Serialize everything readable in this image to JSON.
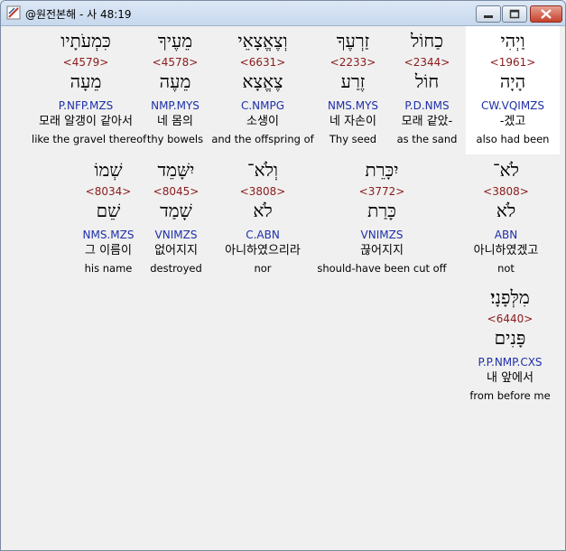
{
  "window": {
    "title": "@원전본해 - 사 48:19",
    "icons": {
      "app": "bible-app-icon",
      "minimize": "minimize-icon",
      "maximize": "maximize-icon",
      "close": "close-icon"
    }
  },
  "rows": [
    [
      {
        "heb": "וַיְהִי",
        "strong": "<1961>",
        "lemma": "הָיָה",
        "morph": "CW.VQIMZS",
        "kor": "-겠고",
        "eng": "also had been",
        "active": true
      },
      {
        "heb": "כַחוֹל",
        "strong": "<2344>",
        "lemma": "חוֹל",
        "morph": "P.D.NMS",
        "kor": "모래 같았-",
        "eng": "as the sand"
      },
      {
        "heb": "זַרְעֶךָ",
        "strong": "<2233>",
        "lemma": "זֶרַע",
        "morph": "NMS.MYS",
        "kor": "네 자손이",
        "eng": "Thy seed"
      },
      {
        "heb": "וְצֶאֱצָאֵי",
        "strong": "<6631>",
        "lemma": "צֶאֱצָא",
        "morph": "C.NMPG",
        "kor": "소생이",
        "eng": "and the offspring of"
      },
      {
        "heb": "מֵעֶיךָ",
        "strong": "<4578>",
        "lemma": "מֵעֶה",
        "morph": "NMP.MYS",
        "kor": "네 몸의",
        "eng": "thy bowels"
      },
      {
        "heb": "כִּמְעֹתָיו",
        "strong": "<4579>",
        "lemma": "מֵעָה",
        "morph": "P.NFP.MZS",
        "kor": "모래 알갱이 같아서",
        "eng": "like the gravel thereof"
      }
    ],
    [
      {
        "heb": "לֹא־",
        "strong": "<3808>",
        "lemma": "לֹא",
        "morph": "ABN",
        "kor": "아니하였겠고",
        "eng": "not"
      },
      {
        "heb": "יִכָּרֵת",
        "strong": "<3772>",
        "lemma": "כָּרַת",
        "morph": "VNIMZS",
        "kor": "끊어지지",
        "eng": "should-have been cut off"
      },
      {
        "heb": "וְלֹא־",
        "strong": "<3808>",
        "lemma": "לֹא",
        "morph": "C.ABN",
        "kor": "아니하였으리라",
        "eng": "nor"
      },
      {
        "heb": "יִשָּׁמֵד",
        "strong": "<8045>",
        "lemma": "שָׁמַד",
        "morph": "VNIMZS",
        "kor": "없어지지",
        "eng": "destroyed"
      },
      {
        "heb": "שְׁמוֹ",
        "strong": "<8034>",
        "lemma": "שֵׁם",
        "morph": "NMS.MZS",
        "kor": "그 이름이",
        "eng": "his name"
      }
    ],
    [
      {
        "heb": "מִלְּפָנָי׃",
        "strong": "<6440>",
        "lemma": "פָּנִים",
        "morph": "P.P.NMP.CXS",
        "kor": "내 앞에서",
        "eng": "from before me"
      }
    ]
  ]
}
